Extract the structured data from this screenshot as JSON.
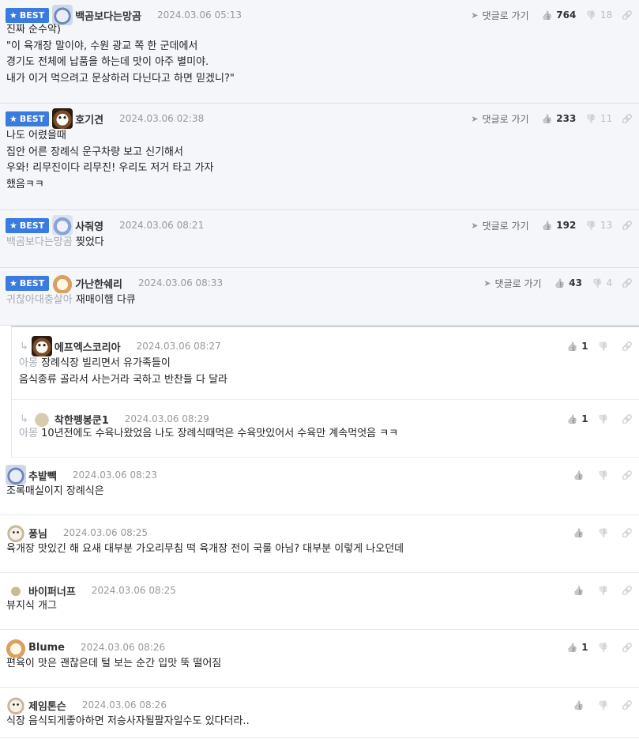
{
  "best_label": "BEST",
  "reply_to_label": "댓글로 가기",
  "comments": [
    {
      "best": true,
      "reply": false,
      "avatar": "bear",
      "nick": "백곰보다는망곰",
      "date": "2024.03.06 05:13",
      "up": "764",
      "down": "18",
      "mention": "",
      "lines": [
        "진짜 순수악)",
        "\"이 육개장 말이야, 수원 광교 쪽 한 군데에서",
        "경기도 전체에 납품을 하는데 맛이 아주 별미야.",
        "내가 이거 먹으려고 문상하러 다닌다고 하면 믿겠니?\""
      ]
    },
    {
      "best": true,
      "reply": false,
      "avatar": "dog",
      "nick": "호기견",
      "date": "2024.03.06 02:38",
      "up": "233",
      "down": "11",
      "mention": "",
      "lines": [
        "나도 어렸을때",
        "집안 어른 장례식 운구차량 보고 신기해서",
        "우와! 리무진이다 리무진! 우리도 저거 타고 가자",
        "했음ㅋㅋ"
      ]
    },
    {
      "best": true,
      "reply": false,
      "avatar": "cat",
      "nick": "사줘영",
      "date": "2024.03.06 08:21",
      "up": "192",
      "down": "13",
      "mention": "백곰보다는망곰",
      "lines": [
        "찢었다"
      ]
    },
    {
      "best": true,
      "reply": false,
      "avatar": "fox",
      "nick": "가난한쉐리",
      "date": "2024.03.06 08:33",
      "up": "43",
      "down": "4",
      "mention": "귀찮아대충살아",
      "lines": [
        "재매이햄 다큐"
      ]
    },
    {
      "best": false,
      "reply": true,
      "avatar": "dog",
      "nick": "에프엑스코리아",
      "date": "2024.03.06 08:27",
      "up": "1",
      "down": "",
      "mention": "아몽",
      "lines": [
        "장례식장 빌리면서 유가족들이",
        "음식종류 골라서 사는거라 국하고 반찬들 다 달라"
      ]
    },
    {
      "best": false,
      "reply": true,
      "avatar": "blob",
      "nick": "착한펭봉쿤1",
      "date": "2024.03.06 08:29",
      "up": "1",
      "down": "",
      "mention": "아몽",
      "lines": [
        "10년전에도 수육나왔었음 나도 장례식때먹은 수육맛있어서 수육만 계속먹엇음 ㅋㅋ"
      ]
    },
    {
      "best": false,
      "reply": false,
      "avatar": "bear",
      "nick": "추밭빽",
      "date": "2024.03.06 08:23",
      "up": "",
      "down": "",
      "mention": "",
      "lines": [
        "조록매실이지 장례식은"
      ]
    },
    {
      "best": false,
      "reply": false,
      "avatar": "pup",
      "nick": "퐁님",
      "date": "2024.03.06 08:25",
      "up": "",
      "down": "",
      "mention": "",
      "lines": [
        "육개장 맛있긴 해 요새 대부분 가오리무침 떡 육개장 전이 국룰 아님? 대부분 이렇게 나오던데"
      ]
    },
    {
      "best": false,
      "reply": false,
      "avatar": "dot",
      "nick": "바이퍼너프",
      "date": "2024.03.06 08:25",
      "up": "",
      "down": "",
      "mention": "",
      "lines": [
        "뷰지식 개그"
      ]
    },
    {
      "best": false,
      "reply": false,
      "avatar": "fox",
      "nick": "Blume",
      "date": "2024.03.06 08:26",
      "up": "1",
      "down": "",
      "mention": "",
      "lines": [
        "편육이 맛은 괜찮은데 털 보는 순간 입맛 뚝 떨어짐"
      ]
    },
    {
      "best": false,
      "reply": false,
      "avatar": "pup",
      "nick": "제임톤슨",
      "date": "2024.03.06 08:26",
      "up": "",
      "down": "",
      "mention": "",
      "lines": [
        "식장 음식되게좋아하면 저승사자될팔자일수도 있다더라.."
      ]
    }
  ]
}
